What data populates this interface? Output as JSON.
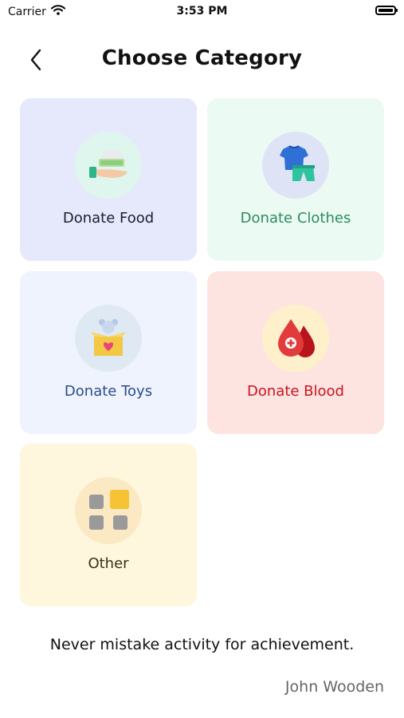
{
  "status_bar": {
    "carrier": "Carrier",
    "time": "3:53 PM"
  },
  "header": {
    "title": "Choose Category"
  },
  "categories": [
    {
      "label": "Donate Food",
      "label_color": "#1a1f2e",
      "icon": "food-hand-icon"
    },
    {
      "label": "Donate Clothes",
      "label_color": "#2e8b5f",
      "icon": "clothes-icon"
    },
    {
      "label": "Donate Toys",
      "label_color": "#2d4b8c",
      "icon": "toy-box-icon"
    },
    {
      "label": "Donate Blood",
      "label_color": "#c8141e",
      "icon": "blood-drop-icon"
    },
    {
      "label": "Other",
      "label_color": "#3a2f16",
      "icon": "grid-squares-icon"
    }
  ],
  "quote": {
    "text": "Never mistake activity for achievement.",
    "author": "John Wooden"
  }
}
